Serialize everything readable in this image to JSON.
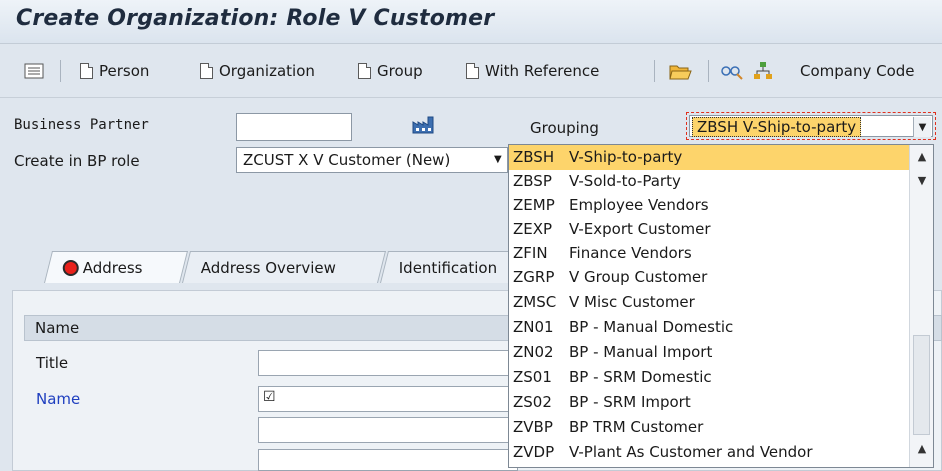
{
  "title": "Create Organization: Role V Customer",
  "toolbar": {
    "items": [
      "Person",
      "Organization",
      "Group",
      "With Reference"
    ],
    "company_code": "Company Code"
  },
  "form": {
    "business_partner_label": "Business Partner",
    "business_partner_value": "",
    "create_in_bp_role_label": "Create in BP role",
    "bp_role_value": "ZCUST X V Customer (New)",
    "grouping_label": "Grouping",
    "grouping_value": "ZBSH V-Ship-to-party"
  },
  "tabs": [
    "Address",
    "Address Overview",
    "Identification"
  ],
  "name_section": {
    "header": "Name",
    "title_label": "Title",
    "name_label": "Name",
    "name_checkbox": "☑"
  },
  "grouping_options": [
    {
      "code": "ZBSH",
      "text": "V-Ship-to-party",
      "selected": true
    },
    {
      "code": "ZBSP",
      "text": "V-Sold-to-Party"
    },
    {
      "code": "ZEMP",
      "text": "Employee Vendors"
    },
    {
      "code": "ZEXP",
      "text": "V-Export Customer"
    },
    {
      "code": "ZFIN",
      "text": "Finance Vendors"
    },
    {
      "code": "ZGRP",
      "text": "V Group Customer"
    },
    {
      "code": "ZMSC",
      "text": "V Misc Customer"
    },
    {
      "code": "ZN01",
      "text": "BP - Manual Domestic"
    },
    {
      "code": "ZN02",
      "text": "BP - Manual Import"
    },
    {
      "code": "ZS01",
      "text": "BP - SRM Domestic"
    },
    {
      "code": "ZS02",
      "text": "BP - SRM Import"
    },
    {
      "code": "ZVBP",
      "text": "BP TRM Customer"
    },
    {
      "code": "ZVDP",
      "text": "V-Plant As Customer and Vendor"
    }
  ],
  "colors": {
    "selected_highlight": "#fdd46b",
    "focus_border": "#e0301e",
    "background": "#dfe6ee"
  }
}
